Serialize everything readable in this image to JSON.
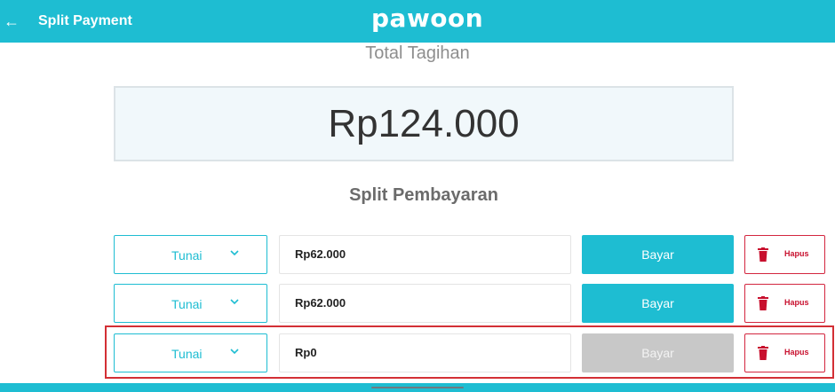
{
  "header": {
    "back_icon": "arrow-left-icon",
    "title": "Split Payment",
    "logo_text": "pawoon"
  },
  "total": {
    "label": "Total Tagihan",
    "amount": "Rp124.000"
  },
  "split": {
    "title": "Split Pembayaran",
    "rows": [
      {
        "method": "Tunai",
        "amount": "Rp62.000",
        "pay_label": "Bayar",
        "pay_enabled": true,
        "delete_label": "Hapus"
      },
      {
        "method": "Tunai",
        "amount": "Rp62.000",
        "pay_label": "Bayar",
        "pay_enabled": true,
        "delete_label": "Hapus"
      },
      {
        "method": "Tunai",
        "amount": "Rp0",
        "pay_label": "Bayar",
        "pay_enabled": false,
        "delete_label": "Hapus"
      }
    ]
  },
  "colors": {
    "accent": "#1ebdd2",
    "danger": "#d3263f",
    "disabled": "#c8c8c8",
    "highlight": "#d32f35"
  }
}
